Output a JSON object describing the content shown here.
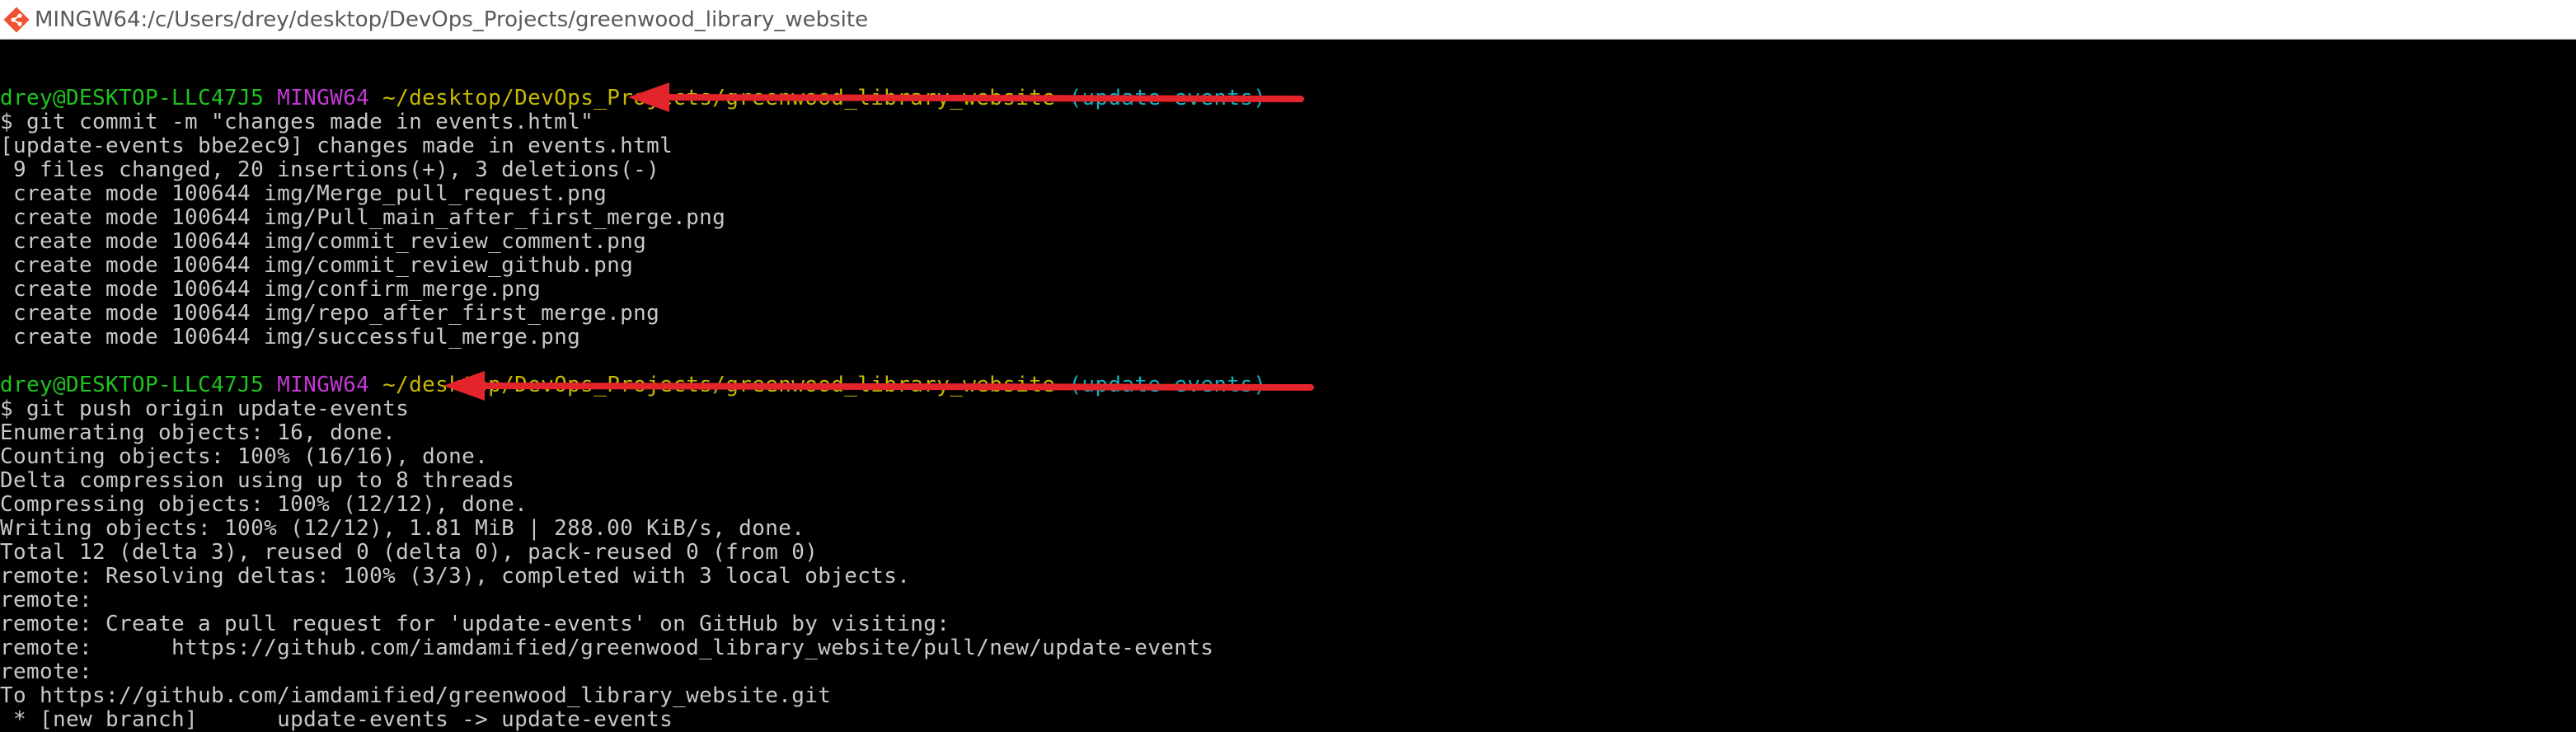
{
  "window": {
    "title": "MINGW64:/c/Users/drey/desktop/DevOps_Projects/greenwood_library_website",
    "icon": "git-bash-icon"
  },
  "colors": {
    "background": "#000000",
    "text": "#c8c8c8",
    "prompt_user": "#1ec31e",
    "prompt_host": "#c238d3",
    "prompt_path": "#c7b800",
    "prompt_branch": "#13b3c0",
    "arrow": "#e3242b"
  },
  "terminal": {
    "blank_top": "",
    "prompt1": {
      "user": "drey@DESKTOP-LLC47J5",
      "host": "MINGW64",
      "path": "~/desktop/DevOps_Projects/greenwood_library_website",
      "branch": "(update-events)"
    },
    "cmd1": "$ git commit -m \"changes made in events.html\"",
    "out1": [
      "[update-events bbe2ec9] changes made in events.html",
      " 9 files changed, 20 insertions(+), 3 deletions(-)",
      " create mode 100644 img/Merge_pull_request.png",
      " create mode 100644 img/Pull_main_after_first_merge.png",
      " create mode 100644 img/commit_review_comment.png",
      " create mode 100644 img/commit_review_github.png",
      " create mode 100644 img/confirm_merge.png",
      " create mode 100644 img/repo_after_first_merge.png",
      " create mode 100644 img/successful_merge.png"
    ],
    "prompt2": {
      "user": "drey@DESKTOP-LLC47J5",
      "host": "MINGW64",
      "path": "~/desktop/DevOps_Projects/greenwood_library_website",
      "branch": "(update-events)"
    },
    "cmd2": "$ git push origin update-events",
    "out2": [
      "Enumerating objects: 16, done.",
      "Counting objects: 100% (16/16), done.",
      "Delta compression using up to 8 threads",
      "Compressing objects: 100% (12/12), done.",
      "Writing objects: 100% (12/12), 1.81 MiB | 288.00 KiB/s, done.",
      "Total 12 (delta 3), reused 0 (delta 0), pack-reused 0 (from 0)",
      "remote: Resolving deltas: 100% (3/3), completed with 3 local objects.",
      "remote:",
      "remote: Create a pull request for 'update-events' on GitHub by visiting:",
      "remote:      https://github.com/iamdamified/greenwood_library_website/pull/new/update-events",
      "remote:",
      "To https://github.com/iamdamified/greenwood_library_website.git",
      " * [new branch]      update-events -> update-events"
    ]
  }
}
